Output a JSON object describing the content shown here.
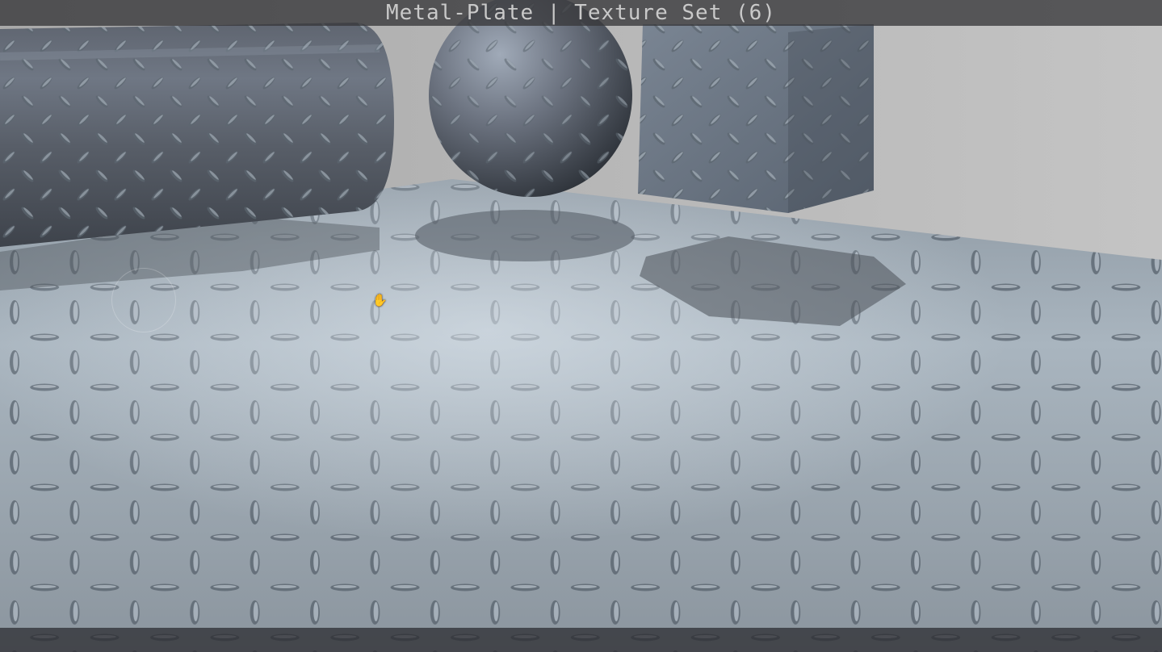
{
  "window": {
    "title": "Metal-Plate | Texture Set (6)"
  },
  "scene": {
    "objects": [
      "cylinder",
      "sphere",
      "cube",
      "floor-plane"
    ],
    "material": "metal diamond tread plate",
    "colors": {
      "background": "#b3b3b3",
      "metal_dark": "#4e5258",
      "metal_light": "#9eabb6",
      "shadow": "#5a6068"
    }
  },
  "icons": {
    "cursor": "hand-cursor-icon"
  }
}
